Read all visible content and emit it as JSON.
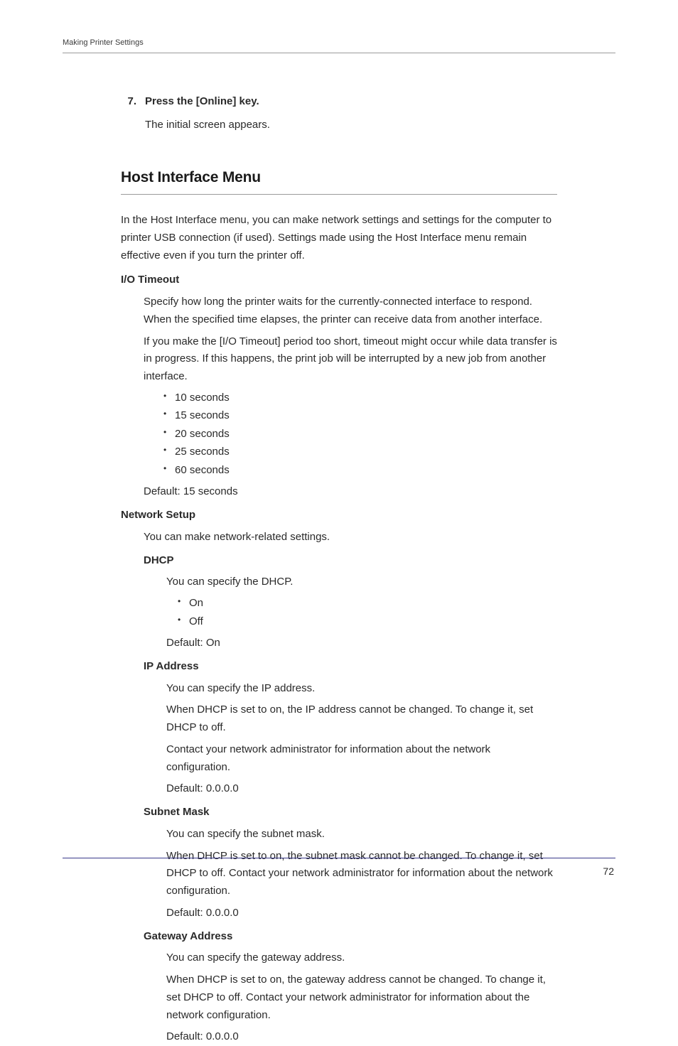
{
  "header": "Making Printer Settings",
  "step": {
    "num": "7.",
    "title": "Press the [Online] key.",
    "sub": "The initial screen appears."
  },
  "section": {
    "title": "Host Interface Menu",
    "intro": "In the Host Interface menu, you can make network settings and settings for the computer to printer USB connection (if used). Settings made using the Host Interface menu remain effective even if you turn the printer off."
  },
  "io_timeout": {
    "term": "I/O Timeout",
    "p1": "Specify how long the printer waits for the currently-connected interface to respond. When the specified time elapses, the printer can receive data from another interface.",
    "p2": "If you make the [I/O Timeout] period too short, timeout might occur while data transfer is in progress. If this happens, the print job will be interrupted by a new job from another interface.",
    "opts": [
      "10 seconds",
      "15 seconds",
      "20 seconds",
      "25 seconds",
      "60 seconds"
    ],
    "default": "Default: 15 seconds"
  },
  "network_setup": {
    "term": "Network Setup",
    "desc": "You can make network-related settings."
  },
  "dhcp": {
    "term": "DHCP",
    "desc": "You can specify the DHCP.",
    "opts": [
      "On",
      "Off"
    ],
    "default": "Default: On"
  },
  "ip": {
    "term": "IP Address",
    "p1": "You can specify the IP address.",
    "p2": "When DHCP is set to on, the IP address cannot be changed. To change it, set DHCP to off.",
    "p3": "Contact your network administrator for information about the network configuration.",
    "default": "Default: 0.0.0.0"
  },
  "subnet": {
    "term": "Subnet Mask",
    "p1": "You can specify the subnet mask.",
    "p2": "When DHCP is set to on, the subnet mask cannot be changed. To change it, set DHCP to off. Contact your network administrator for information about the network configuration.",
    "default": "Default: 0.0.0.0"
  },
  "gateway": {
    "term": "Gateway Address",
    "p1": "You can specify the gateway address.",
    "p2": "When DHCP is set to on, the gateway address cannot be changed. To change it, set DHCP to off. Contact your network administrator for information about the network configuration.",
    "default": "Default: 0.0.0.0"
  },
  "page_number": "72"
}
